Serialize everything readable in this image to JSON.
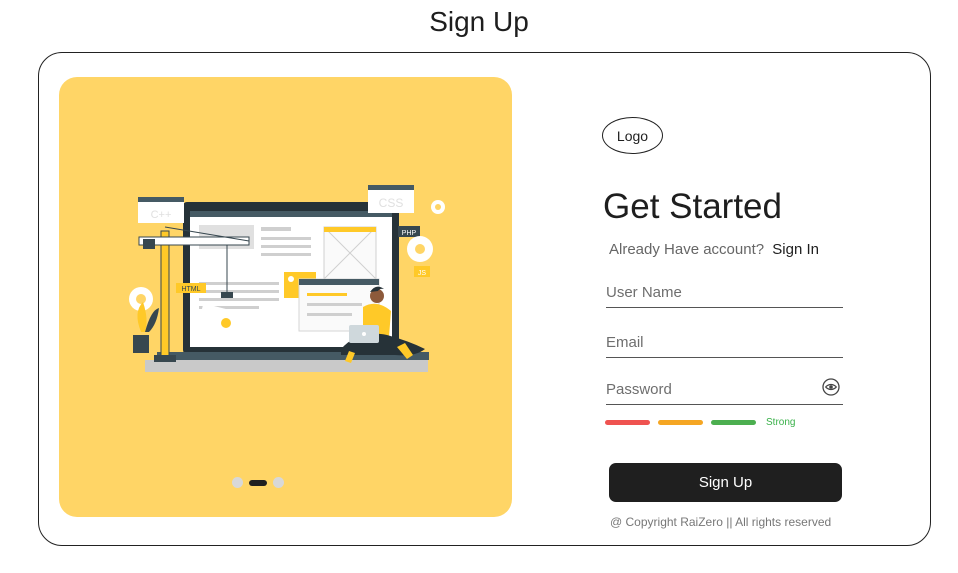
{
  "page": {
    "title": "Sign Up"
  },
  "hero": {
    "carousel": {
      "count": 3,
      "active_index": 1
    },
    "illustration": {
      "labels": {
        "cpp": "C++",
        "css": "CSS",
        "php": "PHP",
        "js": "JS",
        "html": "HTML"
      }
    }
  },
  "form": {
    "logo": "Logo",
    "heading": "Get Started",
    "account_prompt": "Already Have account?",
    "signin_label": "Sign In",
    "username": {
      "placeholder": "User Name",
      "value": ""
    },
    "email": {
      "placeholder": "Email",
      "value": ""
    },
    "password": {
      "placeholder": "Password",
      "value": "",
      "icon": "eye-toggle-icon"
    },
    "strength": {
      "label": "Strong",
      "level": 3,
      "colors": [
        "#ef5350",
        "#f5a623",
        "#4caf50"
      ]
    },
    "submit_label": "Sign Up",
    "copyright": "@ Copyright RaiZero || All rights reserved"
  },
  "colors": {
    "hero_bg": "#ffd566",
    "accent": "#1f1f1f",
    "strength_ok": "#3ab14a"
  }
}
